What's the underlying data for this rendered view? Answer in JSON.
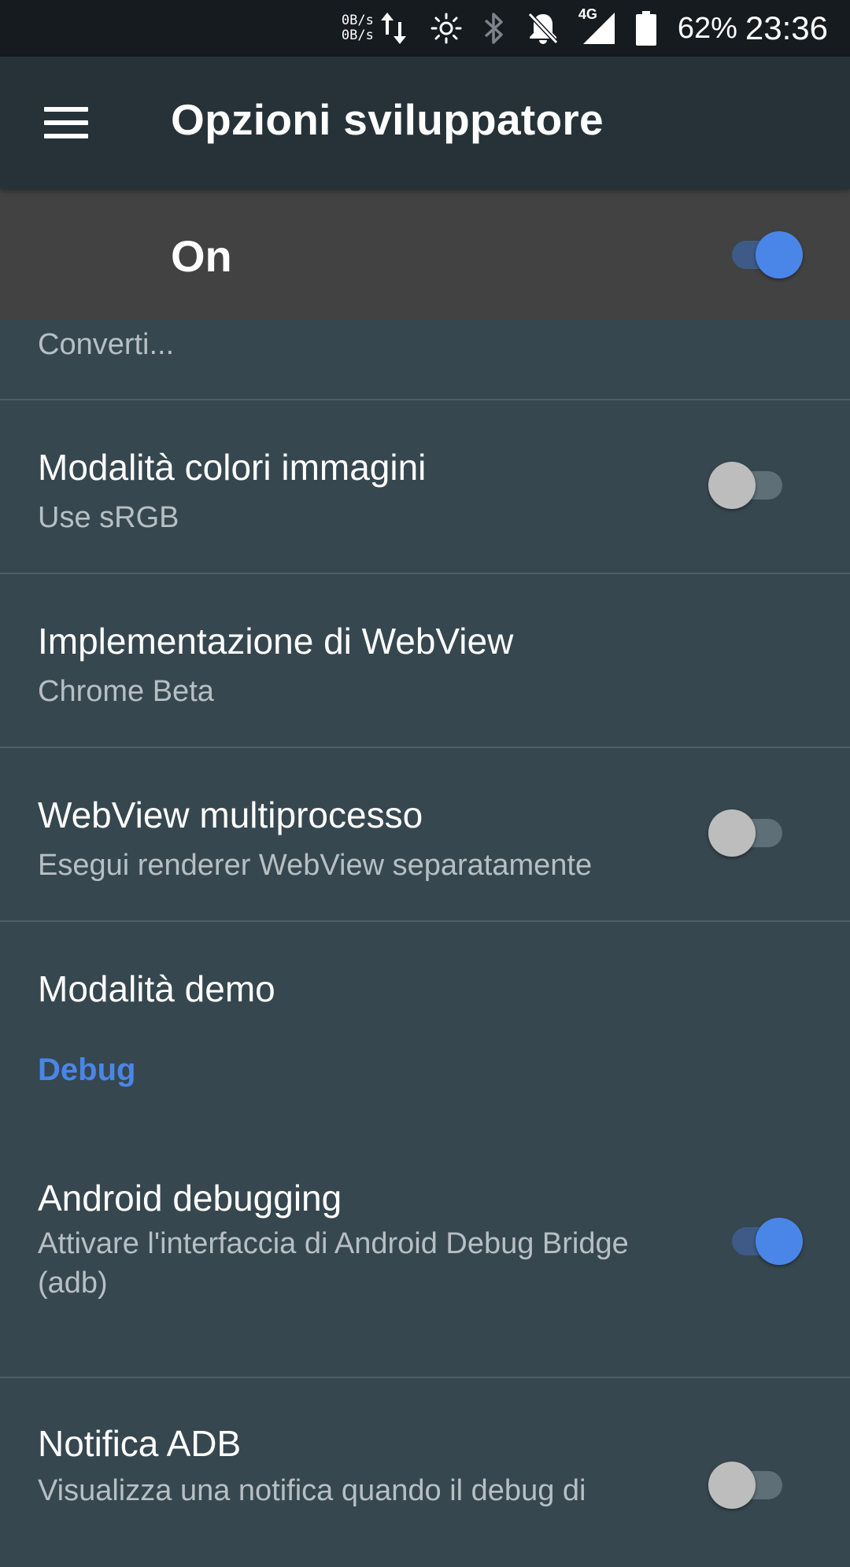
{
  "status_bar": {
    "net_up": "0B/s",
    "net_down": "0B/s",
    "network_type": "4G",
    "battery": "62%",
    "time": "23:36",
    "icons": [
      "data-transfer-icon",
      "brightness-icon",
      "bluetooth-icon",
      "notifications-off-icon",
      "signal-icon",
      "battery-icon"
    ]
  },
  "app_bar": {
    "title": "Opzioni sviluppatore"
  },
  "master_switch": {
    "label": "On",
    "state": "on"
  },
  "items": [
    {
      "subtitle": "Converti..."
    },
    {
      "title": "Modalità colori immagini",
      "subtitle": "Use sRGB",
      "switch": "off"
    },
    {
      "title": "Implementazione di WebView",
      "subtitle": "Chrome Beta"
    },
    {
      "title": "WebView multiprocesso",
      "subtitle": "Esegui renderer WebView separatamente",
      "switch": "off"
    },
    {
      "title": "Modalità demo"
    },
    {
      "section": "Debug"
    },
    {
      "title": "Android debugging",
      "subtitle": "Attivare l'interfaccia di Android Debug Bridge (adb)",
      "switch": "on"
    },
    {
      "title": "Notifica ADB",
      "subtitle": "Visualizza una notifica quando il debug di",
      "switch": "off"
    }
  ],
  "colors": {
    "accent": "#4a86e8",
    "background": "#37474f",
    "app_bar": "#263238",
    "master_row": "#424242"
  }
}
